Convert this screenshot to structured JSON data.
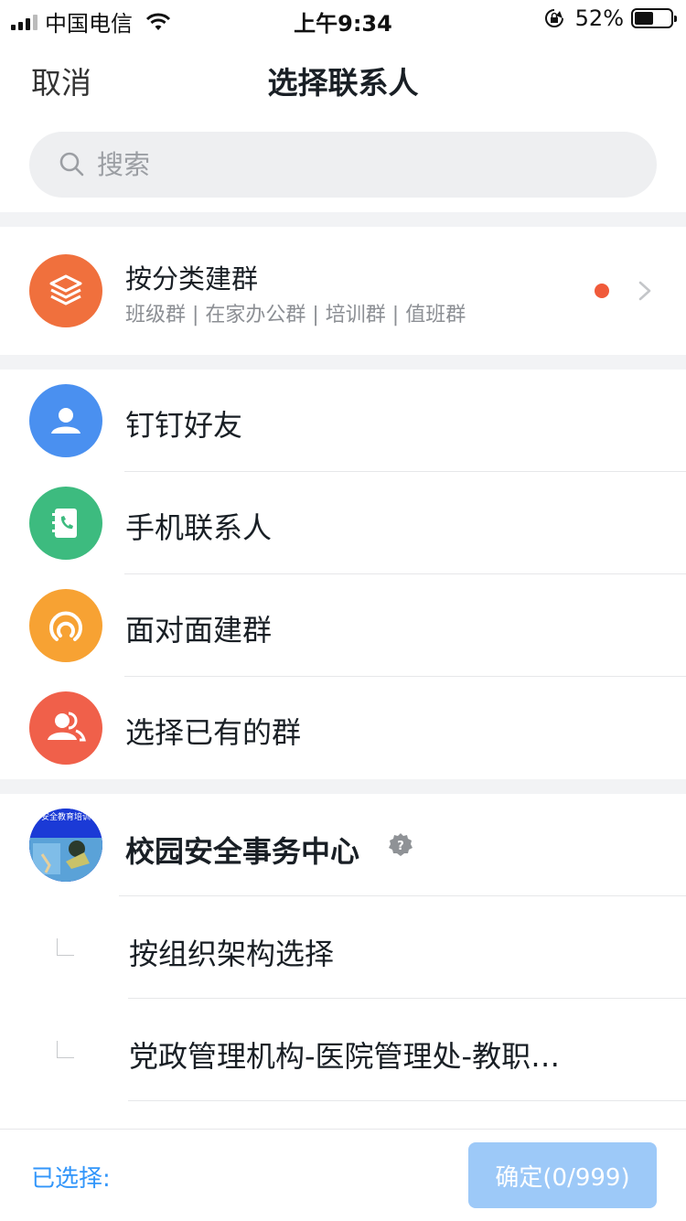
{
  "status_bar": {
    "carrier": "中国电信",
    "time": "上午9:34",
    "battery_percent": "52%",
    "battery_level": 0.52
  },
  "nav": {
    "cancel_label": "取消",
    "title": "选择联系人"
  },
  "search": {
    "placeholder": "搜索",
    "value": ""
  },
  "category_group": {
    "title": "按分类建群",
    "subtitle": "班级群 | 在家办公群 | 培训群 | 值班群",
    "icon": "layers-icon",
    "color": "#f0703d"
  },
  "contact_sources": [
    {
      "label": "钉钉好友",
      "icon": "person-icon",
      "color": "#4a90f0"
    },
    {
      "label": "手机联系人",
      "icon": "phone-book-icon",
      "color": "#3dbb7f"
    },
    {
      "label": "面对面建群",
      "icon": "face-to-face-icon",
      "color": "#f7a233"
    },
    {
      "label": "选择已有的群",
      "icon": "group-icon",
      "color": "#f0604a"
    }
  ],
  "organization": {
    "name": "校园安全事务中心",
    "avatar_text": "安全教育培训",
    "verified_icon": "verified-badge-icon",
    "sub_items": [
      {
        "label": "按组织架构选择"
      },
      {
        "label": "党政管理机构-医院管理处-教职…"
      }
    ]
  },
  "bottom_bar": {
    "selected_label": "已选择:",
    "confirm_label": "确定(0/999)"
  },
  "colors": {
    "accent": "#3296fa",
    "confirm_disabled": "#9dc9f8",
    "divider": "#e6e7e9",
    "section_gap": "#f2f3f5"
  }
}
